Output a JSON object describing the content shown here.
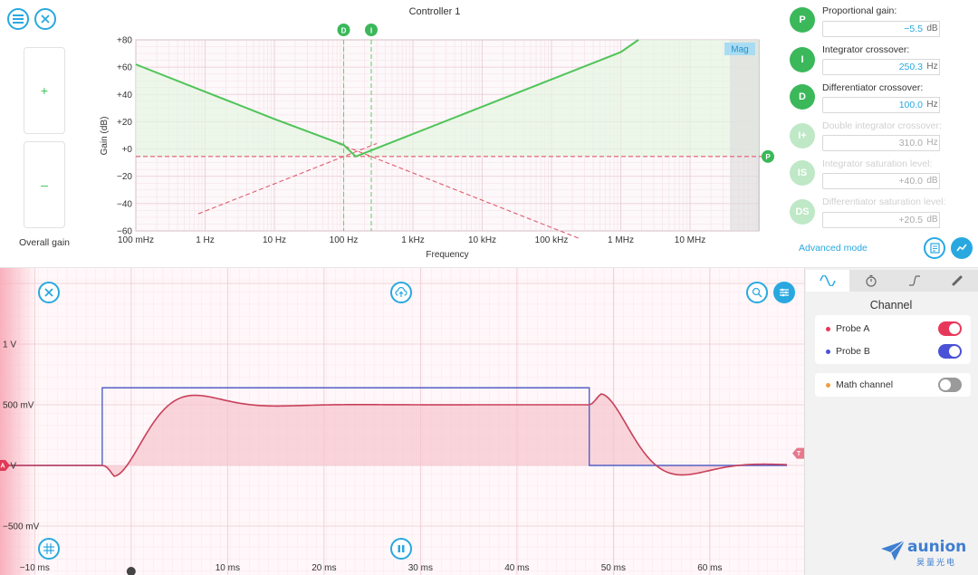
{
  "controller": {
    "title": "Controller 1",
    "overall_gain_label": "Overall gain",
    "plus": "+",
    "minus": "–"
  },
  "bode": {
    "type": "line",
    "ylabel": "Gain (dB)",
    "xlabel": "Frequency",
    "mag_tag": "Mag",
    "x_ticks": [
      "100 mHz",
      "1 Hz",
      "10 Hz",
      "100 Hz",
      "1 kHz",
      "10 kHz",
      "100 kHz",
      "1 MHz",
      "10 MHz"
    ],
    "y_ticks": [
      "+80",
      "+60",
      "+40",
      "+20",
      "+0",
      "−20",
      "−40",
      "−60"
    ],
    "xscale": "log",
    "ylim": [
      -60,
      80
    ],
    "markers": {
      "d": "D",
      "i": "I",
      "p": "P"
    },
    "colors": {
      "response": "#4fc458",
      "asymptote": "#e05c6e",
      "marker": "#3bb85a"
    }
  },
  "chart_data": {
    "type": "line",
    "xscale": "log",
    "xlabel": "Frequency",
    "ylabel": "Gain (dB)",
    "ylim": [
      -60,
      80
    ],
    "series": [
      {
        "x": [
          0.1,
          1,
          10,
          100,
          150,
          250,
          1000,
          10000,
          100000,
          1000000,
          1800000
        ],
        "y": [
          62,
          42,
          22,
          3,
          -5.5,
          -1,
          11,
          31,
          51,
          71,
          80
        ]
      }
    ],
    "proportional_gain_db": -5.5,
    "integrator_crossover_hz": 250.3,
    "differentiator_crossover_hz": 100.0
  },
  "params": {
    "p": {
      "badge": "P",
      "label": "Proportional gain:",
      "value": "−5.5",
      "unit": "dB"
    },
    "i": {
      "badge": "I",
      "label": "Integrator crossover:",
      "value": "250.3",
      "unit": "Hz"
    },
    "d": {
      "badge": "D",
      "label": "Differentiator crossover:",
      "value": "100.0",
      "unit": "Hz"
    },
    "ii": {
      "badge": "I+",
      "label": "Double integrator crossover:",
      "value": "310.0",
      "unit": "Hz"
    },
    "is": {
      "badge": "IS",
      "label": "Integrator saturation level:",
      "value": "+40.0",
      "unit": "dB"
    },
    "ds": {
      "badge": "DS",
      "label": "Differentiator saturation level:",
      "value": "+20.5",
      "unit": "dB"
    },
    "advanced": "Advanced mode"
  },
  "scope": {
    "y_ticks": [
      "1 V",
      "500 mV",
      "0 V",
      "−500 mV"
    ],
    "x_ticks": [
      "−10 ms",
      "0",
      "10 ms",
      "20 ms",
      "30 ms",
      "40 ms",
      "50 ms",
      "60 ms"
    ],
    "trigger_marker": "T",
    "channel_a_marker": "A",
    "colors": {
      "probe_a": "#c8405a",
      "probe_b": "#5560c8",
      "fill": "#f7c4cd"
    }
  },
  "panel": {
    "title": "Channel",
    "probe_a": "Probe A",
    "probe_b": "Probe B",
    "math": "Math channel",
    "colors": {
      "a": "#e8385a",
      "b": "#4a52d6",
      "math": "#f0a040",
      "off": "#999999"
    }
  },
  "brand": {
    "name": "aunion",
    "sub": "昊量光电"
  }
}
